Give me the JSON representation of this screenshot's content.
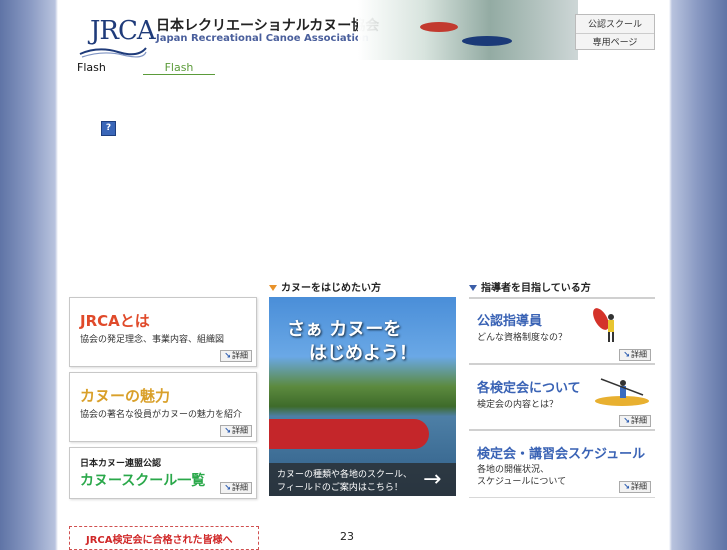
{
  "header": {
    "logo_text": "JRCA",
    "title_jp": "日本レクリエーショナルカヌー協会",
    "title_en": "Japan Recreational Canoe Association",
    "member_box": {
      "line1": "公認スクール",
      "line2": "専用ページ"
    }
  },
  "flash": {
    "label": "Flash",
    "link": "Flash"
  },
  "help_icon": "?",
  "left_cards": [
    {
      "title": "JRCAとは",
      "subtitle": "協会の発足理念、事業内容、組織図",
      "detail": "詳細",
      "title_color": "#e04a2a"
    },
    {
      "title": "カヌーの魅力",
      "subtitle": "協会の著名な役員がカヌーの魅力を紹介",
      "detail": "詳細",
      "title_color": "#d9a02a"
    },
    {
      "pre": "日本カヌー連盟公認",
      "title": "カヌースクール一覧",
      "detail": "詳細",
      "title_color": "#2aa84a"
    }
  ],
  "center": {
    "section_title": "カヌーをはじめたい方",
    "banner_line1": "さぁ カヌーを",
    "banner_line2": "はじめよう！",
    "banner_foot1": "カヌーの種類や各地のスクール、",
    "banner_foot2": "フィールドのご案内はこちら！"
  },
  "right": {
    "section_title": "指導者を目指している方",
    "cards": [
      {
        "title": "公認指導員",
        "subtitle": "どんな資格制度なの？",
        "detail": "詳細"
      },
      {
        "title": "各検定会について",
        "subtitle": "検定会の内容とは？",
        "detail": "詳細"
      },
      {
        "title": "検定会・講習会スケジュール",
        "subtitle": "各地の開催状況、",
        "subtitle2": "スケジュールについて",
        "detail": "詳細"
      }
    ]
  },
  "pass_box": "JRCA検定会に合格された皆様へ",
  "counter": "23",
  "colors": {
    "accent_blue": "#3a63b5",
    "accent_orange": "#e8922a",
    "side_bg": "#6f82b3"
  }
}
